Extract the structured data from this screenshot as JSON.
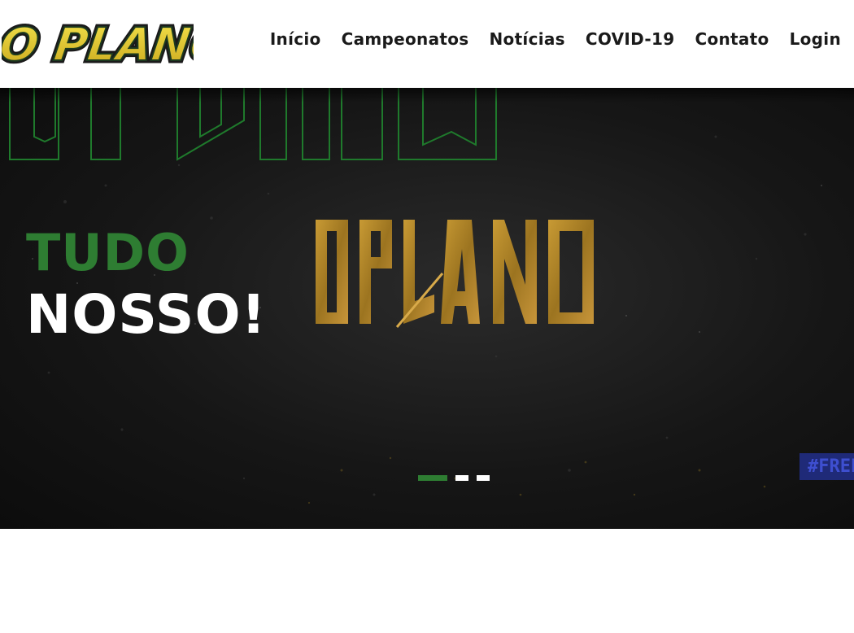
{
  "header": {
    "logo_text": "O PLANO",
    "nav": [
      "Início",
      "Campeonatos",
      "Notícias",
      "COVID-19",
      "Contato",
      "Login"
    ]
  },
  "hero": {
    "headline_line1": "TUDO",
    "headline_line2": "NOSSO!",
    "brand_mark_text": "OPLANO",
    "hashtag": "#FREE",
    "slides_total": 3,
    "active_slide": 1
  },
  "colors": {
    "accent_green": "#2e7d32",
    "hero_bg": "#161616",
    "gold": "#b8862a",
    "hashtag_bg": "#1f2a78"
  }
}
